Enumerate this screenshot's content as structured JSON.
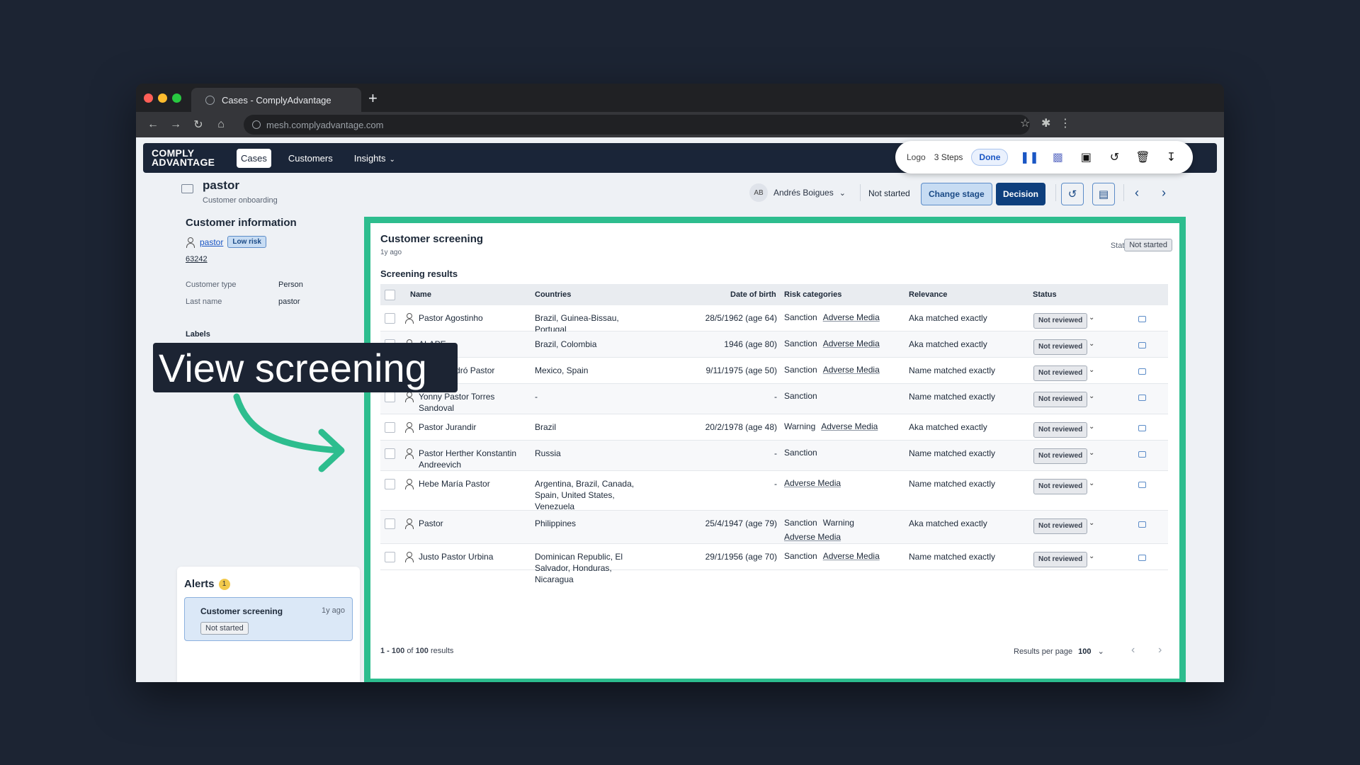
{
  "browser": {
    "tab_title": "Cases - ComplyAdvantage",
    "url": "mesh.complyadvantage.com"
  },
  "nav": {
    "logo": "COMPLY ADVANTAGE",
    "items": [
      {
        "label": "Cases",
        "active": true
      },
      {
        "label": "Customers",
        "active": false
      },
      {
        "label": "Insights",
        "active": false
      }
    ]
  },
  "recorder": {
    "logo_alt": "Logo",
    "steps": "3 Steps",
    "done": "Done"
  },
  "case": {
    "title": "pastor",
    "subtitle": "Customer onboarding",
    "assignee_initials": "AB",
    "assignee": "Andrés Boigues",
    "stage": "Not started",
    "change_stage": "Change stage",
    "decision": "Decision"
  },
  "customer_info": {
    "title": "Customer information",
    "name": "pastor",
    "risk": "Low risk",
    "id": "63242",
    "fields": [
      {
        "key": "Customer type",
        "value": "Person"
      },
      {
        "key": "Last name",
        "value": "pastor"
      }
    ],
    "labels_title": "Labels"
  },
  "alerts": {
    "title": "Alerts",
    "count": "1",
    "card_title": "Customer screening",
    "card_time": "1y ago",
    "card_status": "Not started"
  },
  "screening": {
    "title": "Customer screening",
    "time": "1y ago",
    "status_label": "Status",
    "status": "Not started",
    "results_title": "Screening results",
    "columns": [
      "Name",
      "Countries",
      "Date of birth",
      "Risk categories",
      "Relevance",
      "Status"
    ],
    "rows": [
      {
        "name": [
          "Pastor Agostinho"
        ],
        "countries": [
          "Brazil, Guinea-Bissau, Portugal"
        ],
        "dob": "28/5/1962 (age 64)",
        "risk": [
          "Sanction"
        ],
        "risk_links": [
          "Adverse Media"
        ],
        "relevance": "Aka matched exactly",
        "status": "Not reviewed",
        "h": 37
      },
      {
        "name": [
          "ALAPE"
        ],
        "countries": [
          "Brazil, Colombia"
        ],
        "dob": "1946 (age 80)",
        "risk": [
          "Sanction"
        ],
        "risk_links": [
          "Adverse Media"
        ],
        "relevance": "Aka matched exactly",
        "status": "Not reviewed",
        "h": 37
      },
      {
        "name": [
          "Alvaro Padró Pastor"
        ],
        "countries": [
          "Mexico, Spain"
        ],
        "dob": "9/11/1975 (age 50)",
        "risk": [
          "Sanction"
        ],
        "risk_links": [
          "Adverse Media"
        ],
        "relevance": "Name matched exactly",
        "status": "Not reviewed",
        "h": 37
      },
      {
        "name": [
          "Yonny Pastor Torres",
          "Sandoval"
        ],
        "countries": [
          "-"
        ],
        "dob": "-",
        "risk": [
          "Sanction"
        ],
        "risk_links": [],
        "relevance": "Name matched exactly",
        "status": "Not reviewed",
        "h": 43
      },
      {
        "name": [
          "Pastor Jurandir"
        ],
        "countries": [
          "Brazil"
        ],
        "dob": "20/2/1978 (age 48)",
        "risk": [
          "Warning"
        ],
        "risk_links": [
          "Adverse Media"
        ],
        "relevance": "Aka matched exactly",
        "status": "Not reviewed",
        "h": 37
      },
      {
        "name": [
          "Pastor Herther Konstantin",
          "Andreevich"
        ],
        "countries": [
          "Russia"
        ],
        "dob": "-",
        "risk": [
          "Sanction"
        ],
        "risk_links": [],
        "relevance": "Name matched exactly",
        "status": "Not reviewed",
        "h": 43
      },
      {
        "name": [
          "Hebe María Pastor"
        ],
        "countries": [
          "Argentina, Brazil, Canada,",
          "Spain, United States,",
          "Venezuela"
        ],
        "dob": "-",
        "risk": [],
        "risk_links": [
          "Adverse Media"
        ],
        "relevance": "Name matched exactly",
        "status": "Not reviewed",
        "h": 56
      },
      {
        "name": [
          "Pastor"
        ],
        "countries": [
          "Philippines"
        ],
        "dob": "25/4/1947 (age 79)",
        "risk": [
          "Sanction",
          "Warning"
        ],
        "risk_links": [
          "Adverse Media"
        ],
        "relevance": "Aka matched exactly",
        "status": "Not reviewed",
        "h": 47
      },
      {
        "name": [
          "Justo Pastor Urbina"
        ],
        "countries": [
          "Dominican Republic, El",
          "Salvador, Honduras, Nicaragua"
        ],
        "dob": "29/1/1956 (age 70)",
        "risk": [
          "Sanction"
        ],
        "risk_links": [
          "Adverse Media"
        ],
        "relevance": "Name matched exactly",
        "status": "Not reviewed",
        "h": 37
      }
    ],
    "pager": {
      "range": "1 - 100",
      "of": "of",
      "total": "100",
      "suffix": "results"
    },
    "results_per_page_label": "Results per page",
    "results_per_page": "100"
  },
  "annotation": {
    "callout": "View screening",
    "arrow_color": "#2dbd8e"
  },
  "colors": {
    "highlight": "#2dbd8e",
    "brand_dark": "#1a2538",
    "primary": "#0e3f7d"
  }
}
